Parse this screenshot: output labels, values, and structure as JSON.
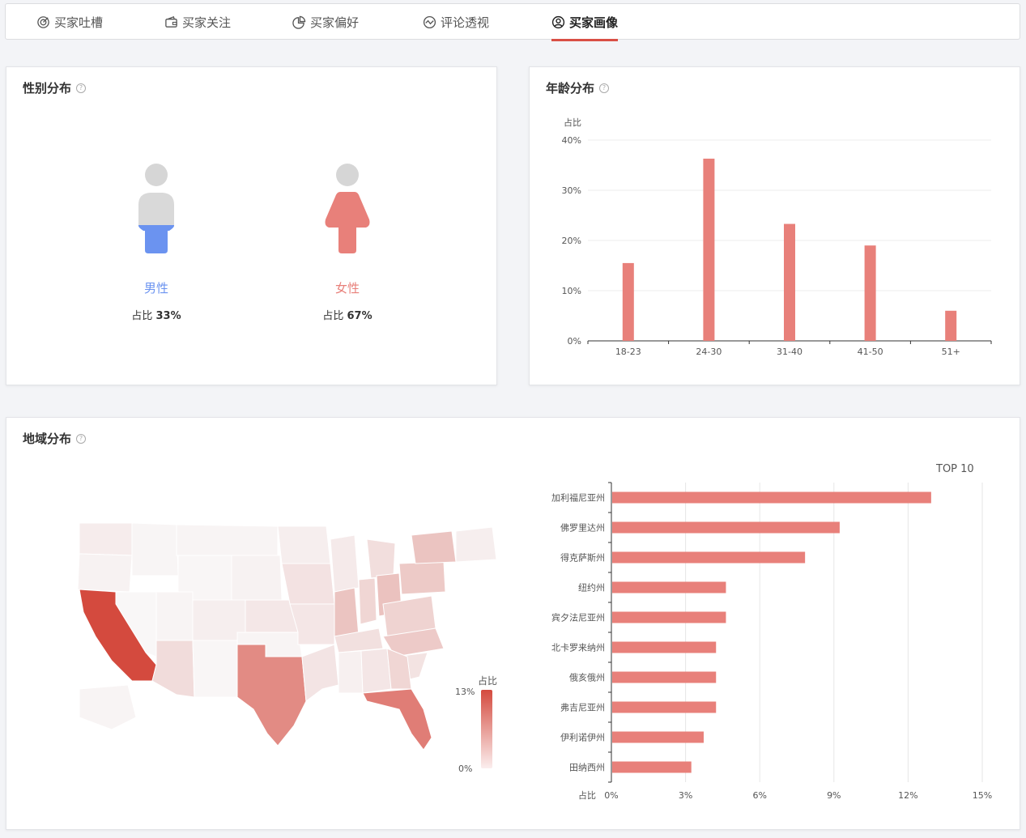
{
  "tabs": [
    {
      "label": "买家吐槽",
      "icon": "target-icon",
      "active": false
    },
    {
      "label": "买家关注",
      "icon": "wallet-icon",
      "active": false
    },
    {
      "label": "买家偏好",
      "icon": "pie-chart-icon",
      "active": false
    },
    {
      "label": "评论透视",
      "icon": "trend-icon",
      "active": false
    },
    {
      "label": "买家画像",
      "icon": "user-circle-icon",
      "active": true
    }
  ],
  "gender": {
    "title": "性别分布",
    "male": {
      "label": "男性",
      "pct_prefix": "占比",
      "pct": "33%",
      "color": "#6b93f0"
    },
    "female": {
      "label": "女性",
      "pct_prefix": "占比",
      "pct": "67%",
      "color": "#e8807a"
    }
  },
  "age": {
    "title": "年龄分布"
  },
  "region": {
    "title": "地域分布",
    "top_label": "TOP 10",
    "legend_title": "占比",
    "legend_max": "13%",
    "legend_min": "0%"
  },
  "chart_data": [
    {
      "type": "bar",
      "title": "年龄分布",
      "ylabel": "占比",
      "categories": [
        "18-23",
        "24-30",
        "31-40",
        "41-50",
        "51+"
      ],
      "values": [
        15.5,
        36.3,
        23.3,
        19.0,
        6.0
      ],
      "yticks": [
        "0%",
        "10%",
        "20%",
        "30%",
        "40%"
      ],
      "ylim": [
        0,
        40
      ],
      "color": "#e8807a"
    },
    {
      "type": "bar",
      "orientation": "horizontal",
      "title": "TOP 10",
      "xlabel": "占比",
      "categories": [
        "加利福尼亚州",
        "佛罗里达州",
        "得克萨斯州",
        "纽约州",
        "宾夕法尼亚州",
        "北卡罗来纳州",
        "俄亥俄州",
        "弗吉尼亚州",
        "伊利诺伊州",
        "田纳西州"
      ],
      "values": [
        12.9,
        9.2,
        7.8,
        4.6,
        4.6,
        4.2,
        4.2,
        4.2,
        3.7,
        3.2
      ],
      "xticks": [
        "0%",
        "3%",
        "6%",
        "9%",
        "12%",
        "15%"
      ],
      "xlim": [
        0,
        15
      ],
      "color": "#e8807a"
    }
  ]
}
